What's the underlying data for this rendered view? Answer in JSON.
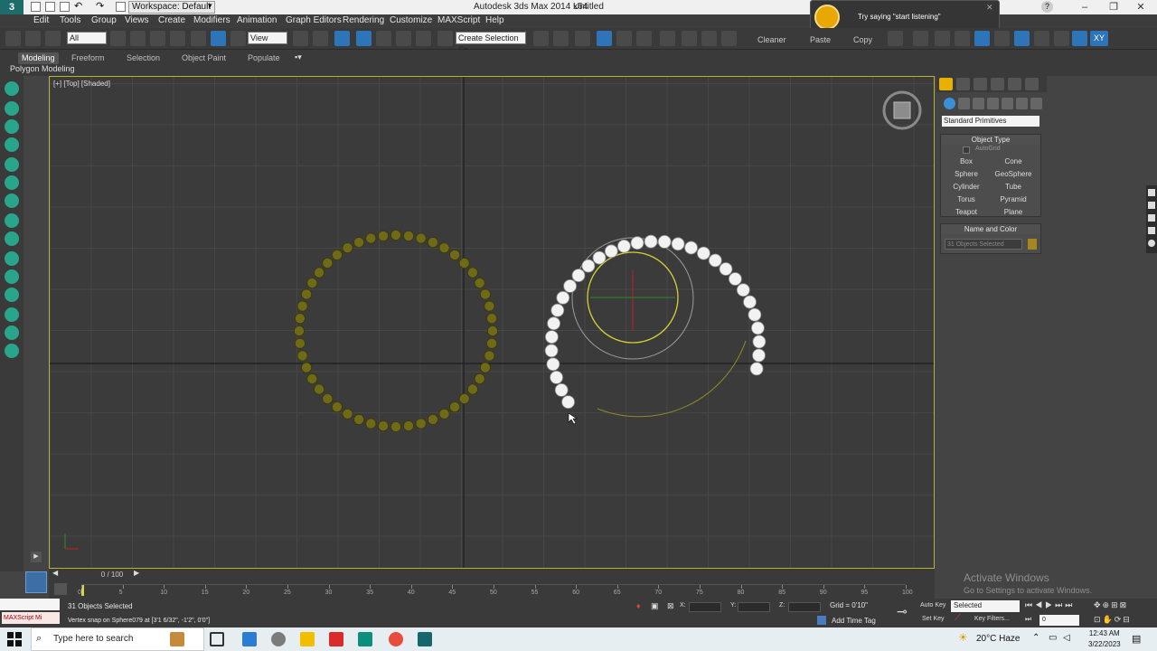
{
  "titlebar": {
    "workspace": "Workspace: Default",
    "app_title": "Autodesk 3ds Max  2014 x64",
    "doc_title": "Untitled",
    "help_icon": "?"
  },
  "menu": [
    "Edit",
    "Tools",
    "Group",
    "Views",
    "Create",
    "Modifiers",
    "Animation",
    "Graph Editors",
    "Rendering",
    "Customize",
    "MAXScript",
    "Help"
  ],
  "toolbar": {
    "filter_value": "All",
    "coord_system": "View",
    "named_selection_placeholder": "Create Selection Se",
    "cleaner_label": "Cleaner",
    "paste_label": "Paste",
    "copy_label": "Copy",
    "xy_label": "XY"
  },
  "ribbon": {
    "tabs": [
      "Modeling",
      "Freeform",
      "Selection",
      "Object Paint",
      "Populate"
    ],
    "active_tab": "Modeling",
    "sub_label": "Polygon Modeling"
  },
  "viewport": {
    "label": "[+] [Top] [Shaded]",
    "colors": {
      "gold": "#6f6a18",
      "white": "#f2f2f2",
      "yellow": "#c8c232",
      "grid_major": "#1e1e1e"
    }
  },
  "command_panel": {
    "category": "Standard Primitives",
    "object_type_title": "Object Type",
    "autogrid_label": "AutoGrid",
    "primitives": [
      "Box",
      "Cone",
      "Sphere",
      "GeoSphere",
      "Cylinder",
      "Tube",
      "Torus",
      "Pyramid",
      "Teapot",
      "Plane"
    ],
    "name_color_title": "Name and Color",
    "name_value": "31 Objects Selected"
  },
  "timeline": {
    "slider_text": "0 / 100",
    "ticks": [
      "0",
      "5",
      "10",
      "15",
      "20",
      "25",
      "30",
      "35",
      "40",
      "45",
      "50",
      "55",
      "60",
      "65",
      "70",
      "75",
      "80",
      "85",
      "90",
      "95",
      "100"
    ]
  },
  "status": {
    "maxscript": "MAXScript Mi",
    "selected_count": "31 Objects Selected",
    "prompt": "Vertex snap on Sphere079 at [3'1 6/32\", -1'2\", 0'0\"]",
    "x_label": "X:",
    "y_label": "Y:",
    "z_label": "Z:",
    "grid": "Grid = 0'10\"",
    "add_time_tag": "Add Time Tag",
    "auto_key": "Auto Key",
    "set_key": "Set Key",
    "selected_dropdown": "Selected",
    "key_filters": "Key Filters...",
    "frame_value": "0"
  },
  "notification": {
    "text": "Try saying \"start listening\""
  },
  "watermark": {
    "title": "Activate Windows",
    "subtitle": "Go to Settings to activate Windows."
  },
  "taskbar": {
    "search_placeholder": "Type here to search",
    "weather": "20°C  Haze",
    "time": "12:43 AM",
    "date": "3/22/2023"
  }
}
